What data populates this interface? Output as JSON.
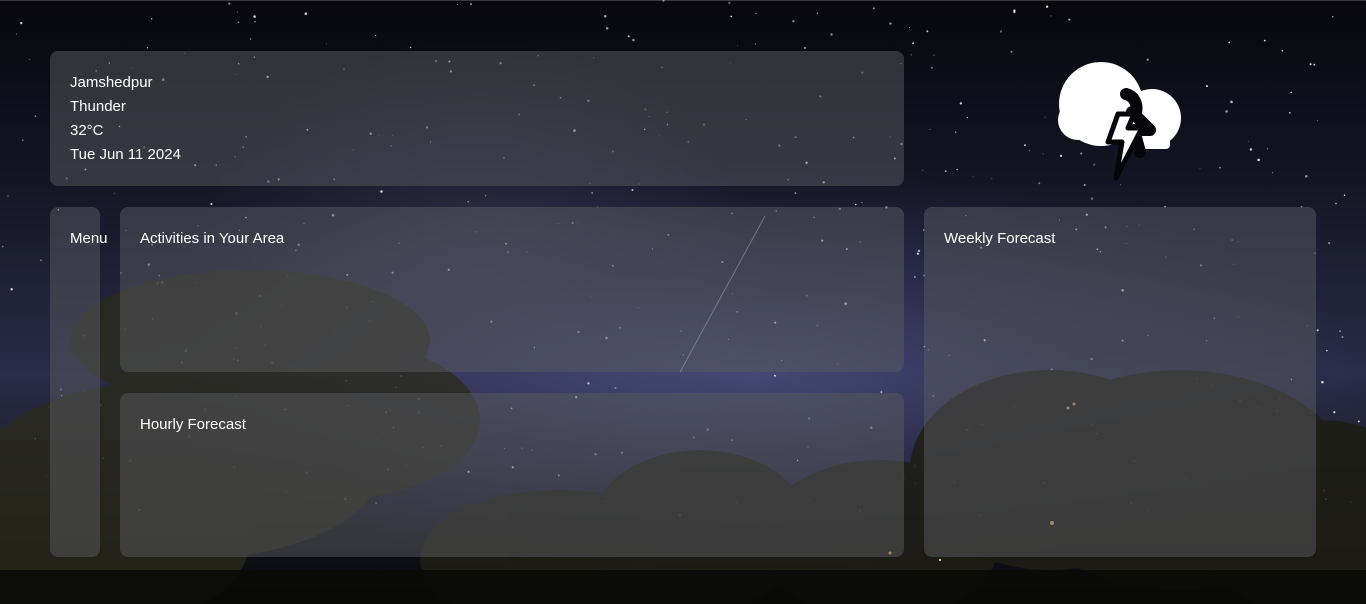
{
  "location": {
    "city": "Jamshedpur",
    "condition": "Thunder",
    "temperature": "32°C",
    "date": "Tue Jun 11 2024"
  },
  "weather_icon": "thunderstorm-cloud-icon",
  "menu": {
    "label": "Menu"
  },
  "activities": {
    "title": "Activities in Your Area"
  },
  "hourly": {
    "title": "Hourly Forecast"
  },
  "weekly": {
    "title": "Weekly Forecast"
  },
  "colors": {
    "panel_bg": "rgba(90,90,96,0.5)",
    "text": "#ffffff",
    "sky_glow": "#2a2c48"
  }
}
